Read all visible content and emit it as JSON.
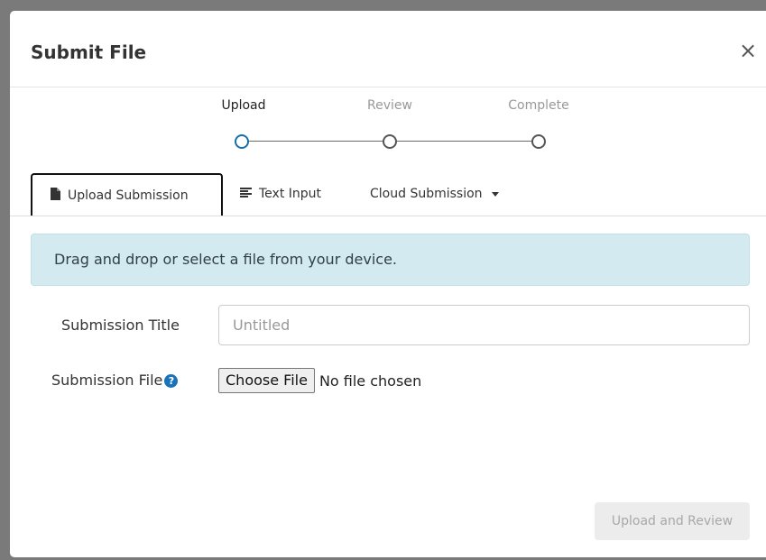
{
  "modal": {
    "title": "Submit File",
    "close_label": "×"
  },
  "steps": [
    {
      "label": "Upload",
      "active": true
    },
    {
      "label": "Review",
      "active": false
    },
    {
      "label": "Complete",
      "active": false
    }
  ],
  "tabs": [
    {
      "label": "Upload Submission",
      "icon": "file-icon",
      "active": true
    },
    {
      "label": "Text Input",
      "icon": "text-lines-icon",
      "active": false
    },
    {
      "label": "Cloud Submission",
      "icon": "caret-down-icon",
      "active": false
    }
  ],
  "alert": {
    "text": "Drag and drop or select a file from your device."
  },
  "form": {
    "title_label": "Submission Title",
    "title_placeholder": "Untitled",
    "title_value": "",
    "file_label": "Submission File",
    "help_glyph": "?",
    "choose_file_label": "Choose File",
    "no_file_text": "No file chosen"
  },
  "footer": {
    "submit_label": "Upload and Review",
    "submit_disabled": true
  },
  "colors": {
    "accent": "#1a6ea8",
    "alert_bg": "#d2eaf0",
    "backdrop": "#7a7a7a"
  }
}
